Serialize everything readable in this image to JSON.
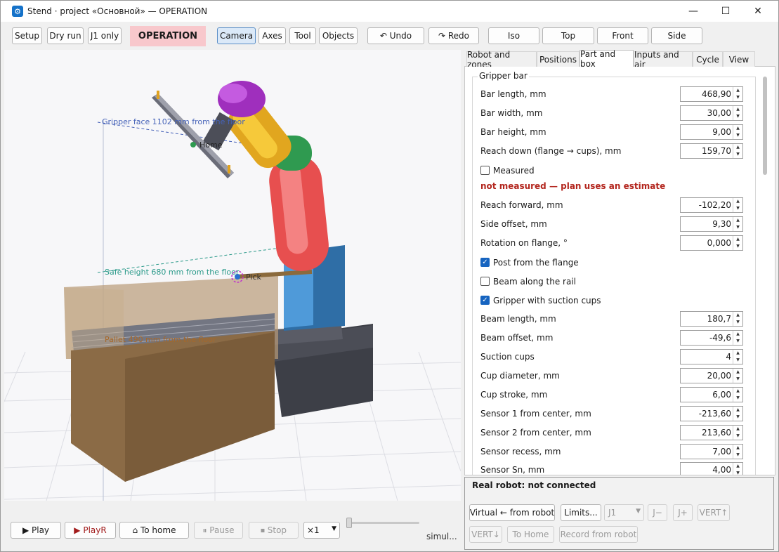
{
  "window": {
    "title": "Stend · project «Основной» — OPERATION",
    "minimize_icon": "minimize-icon",
    "maximize_icon": "maximize-icon",
    "close_icon": "close-icon"
  },
  "toolbar": {
    "setup": "Setup",
    "dry_run": "Dry run",
    "j1_only": "J1 only",
    "mode_badge": "OPERATION",
    "camera": "Camera",
    "axes": "Axes",
    "tool": "Tool",
    "objects": "Objects",
    "undo": "↶ Undo",
    "redo": "↷ Redo",
    "iso": "Iso",
    "top": "Top",
    "front": "Front",
    "side": "Side"
  },
  "viewport": {
    "gripper_face_label": "Gripper face 1102 mm from the floor",
    "home_label": "Home",
    "safe_height_label": "Safe height 680 mm from the floor",
    "pick_label": "Pick",
    "pallet_label": "Pallet 490 mm from the floor",
    "colors": {
      "arm_red": "#f06a6a",
      "arm_green": "#3aa35a",
      "arm_yellow": "#f0c132",
      "arm_orange": "#d98a1e",
      "gripper_head": "#b43fcf",
      "base_blue": "#4a93d4",
      "pedestal": "#3f4047",
      "box": "#8a6a45"
    }
  },
  "bottombar": {
    "play": "▶ Play",
    "playr": "▶ PlayR",
    "to_home": "⌂ To home",
    "pause": "⏸ Pause",
    "stop": "⏹ Stop",
    "speed": "×1",
    "status": "simul..."
  },
  "tabs": [
    "Robot and zones",
    "Positions",
    "Part and box",
    "Inputs and air",
    "Cycle",
    "View"
  ],
  "part": {
    "group_title": "Gripper bar",
    "bar_length": {
      "label": "Bar length, mm",
      "value": "468,90"
    },
    "bar_width": {
      "label": "Bar width, mm",
      "value": "30,00"
    },
    "bar_height": {
      "label": "Bar height, mm",
      "value": "9,00"
    },
    "reach_down": {
      "label": "Reach down (flange → cups), mm",
      "value": "159,70"
    },
    "measured": {
      "label": "Measured",
      "checked": false
    },
    "warning": "not measured — plan uses an estimate",
    "reach_forward": {
      "label": "Reach forward, mm",
      "value": "-102,20"
    },
    "side_offset": {
      "label": "Side offset, mm",
      "value": "9,30"
    },
    "rotation": {
      "label": "Rotation on flange, °",
      "value": "0,000"
    },
    "post_from_flange": {
      "label": "Post from the flange",
      "checked": true
    },
    "beam_along_rail": {
      "label": "Beam along the rail",
      "checked": false
    },
    "gripper_suction": {
      "label": "Gripper with suction cups",
      "checked": true
    },
    "beam_length": {
      "label": "Beam length, mm",
      "value": "180,7"
    },
    "beam_offset": {
      "label": "Beam offset, mm",
      "value": "-49,6"
    },
    "suction_cups": {
      "label": "Suction cups",
      "value": "4"
    },
    "cup_diameter": {
      "label": "Cup diameter, mm",
      "value": "20,00"
    },
    "cup_stroke": {
      "label": "Cup stroke, mm",
      "value": "6,00"
    },
    "sensor1": {
      "label": "Sensor 1 from center, mm",
      "value": "-213,60"
    },
    "sensor2": {
      "label": "Sensor 2 from center, mm",
      "value": "213,60"
    },
    "sensor_recess": {
      "label": "Sensor recess, mm",
      "value": "7,00"
    },
    "sensor_sn": {
      "label": "Sensor Sn, mm",
      "value": "4,00"
    }
  },
  "robot": {
    "status": "Real robot: not connected",
    "virtual_from_robot": "Virtual ← from robot",
    "limits": "Limits...",
    "joint_select": "J1",
    "j_minus": "J−",
    "j_plus": "J+",
    "vert_up": "VERT↑",
    "vert_down": "VERT↓",
    "to_home": "To Home",
    "record": "Record from robot"
  }
}
